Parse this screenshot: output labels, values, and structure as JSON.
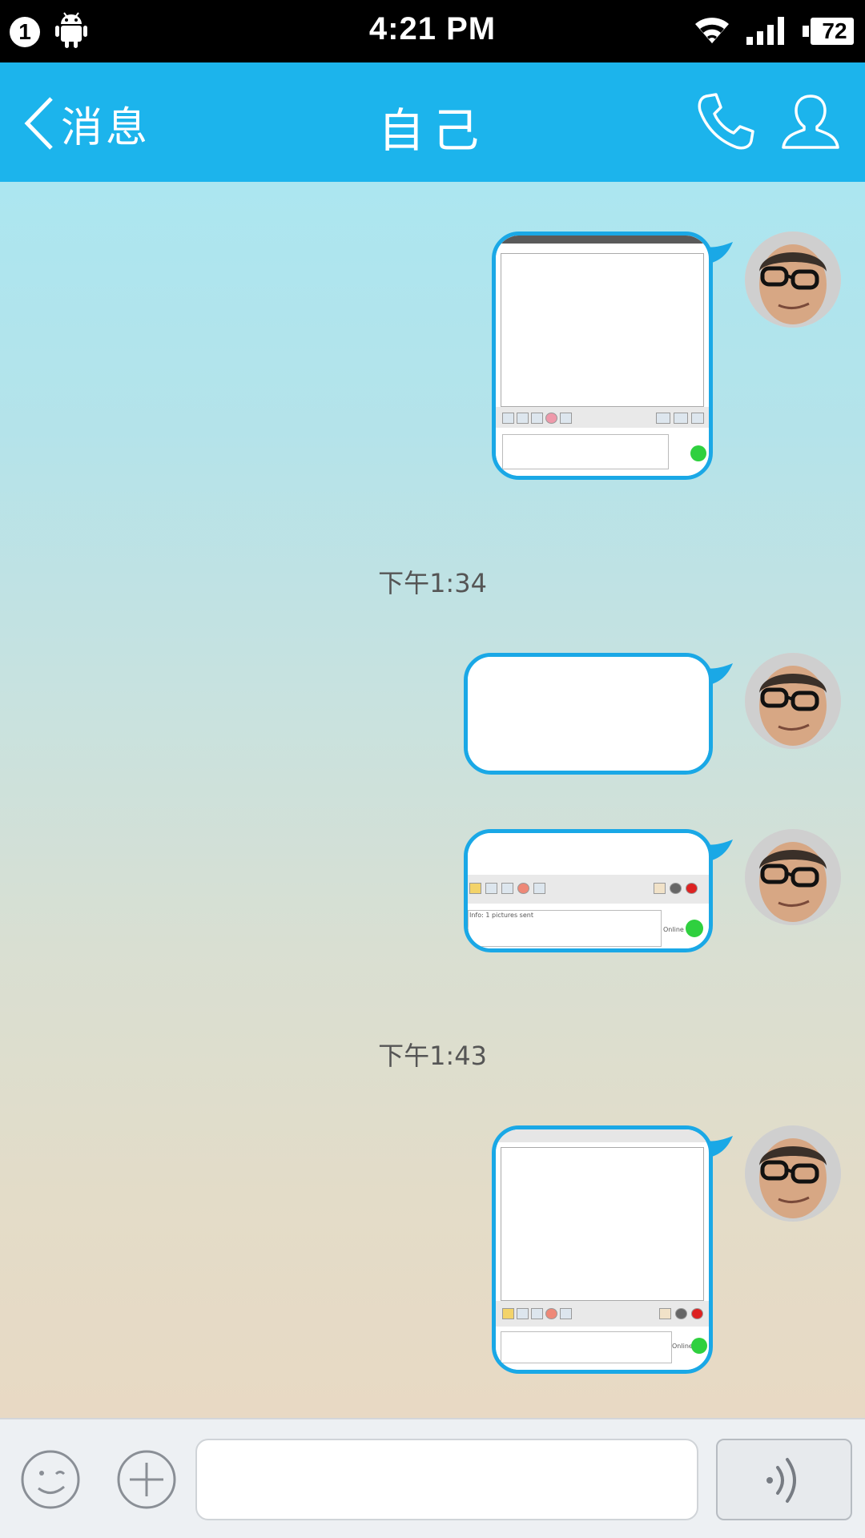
{
  "status_bar": {
    "notification_badge": "1",
    "time": "4:21 PM",
    "battery": "72",
    "icons": [
      "android-icon",
      "wifi-icon",
      "signal-icon",
      "battery-icon"
    ]
  },
  "header": {
    "back_label": "消息",
    "title": "自己",
    "icons": [
      "back-chevron-icon",
      "phone-icon",
      "profile-icon"
    ],
    "background_color": "#1cb4ec"
  },
  "chat": {
    "messages": [
      {
        "type": "image",
        "sender": "self"
      },
      {
        "type": "timestamp",
        "text": "下午1:34"
      },
      {
        "type": "image",
        "sender": "self"
      },
      {
        "type": "image",
        "sender": "self",
        "caption": "Info: 1 pictures sent",
        "status": "Online"
      },
      {
        "type": "timestamp",
        "text": "下午1:43"
      },
      {
        "type": "image",
        "sender": "self",
        "status": "Online"
      }
    ],
    "bubble_border_color": "#1aa8e6"
  },
  "input_bar": {
    "input_value": "",
    "icons": [
      "emoji-icon",
      "plus-icon",
      "voice-icon"
    ]
  }
}
